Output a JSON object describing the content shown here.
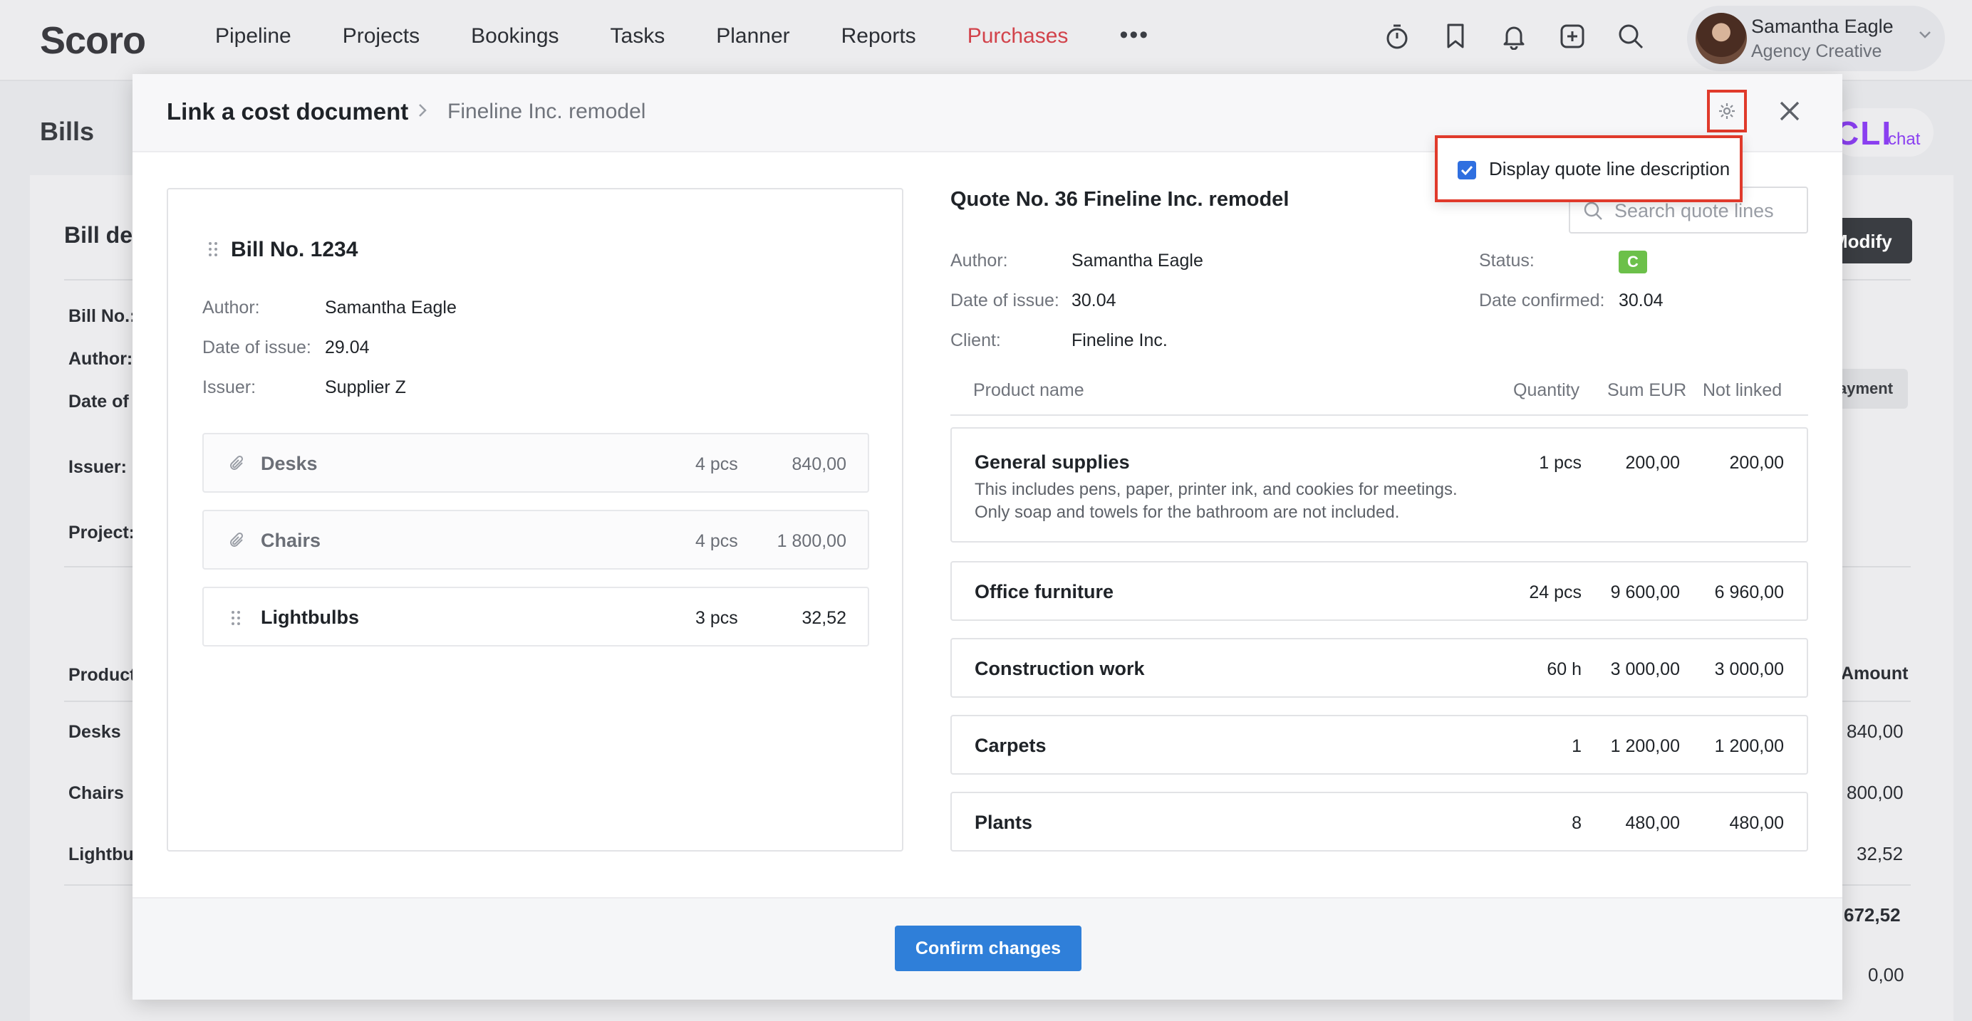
{
  "app": {
    "logo": "Scoro",
    "nav": [
      "Pipeline",
      "Projects",
      "Bookings",
      "Tasks",
      "Planner",
      "Reports",
      "Purchases"
    ],
    "nav_more": "•••",
    "user": {
      "name": "Samantha Eagle",
      "role": "Agency Creative"
    }
  },
  "background": {
    "page_title": "Bills",
    "chat_logo": "CLI",
    "chat_label": "chat",
    "section_title": "Bill de",
    "labels": [
      "Bill No.:",
      "Author:",
      "Date of",
      "Issuer:",
      "Project:"
    ],
    "modify_button": "Modify",
    "payment_button": "ayment",
    "table_header_product": "Product",
    "table_header_amount": "Amount",
    "rows": [
      {
        "product": "Desks",
        "amount": "840,00"
      },
      {
        "product": "Chairs",
        "amount": "800,00"
      },
      {
        "product": "Lightbu",
        "amount": "32,52"
      }
    ],
    "total": "672,52",
    "footer_value": "0,00"
  },
  "modal": {
    "title": "Link a cost document",
    "subtitle": "Fineline Inc. remodel",
    "settings_option": "Display quote line description",
    "settings_checked": true,
    "confirm_button": "Confirm changes",
    "bill": {
      "title": "Bill No. 1234",
      "author_label": "Author:",
      "author": "Samantha Eagle",
      "date_label": "Date of issue:",
      "date": "29.04",
      "issuer_label": "Issuer:",
      "issuer": "Supplier Z",
      "lines": [
        {
          "name": "Desks",
          "qty": "4 pcs",
          "sum": "840,00",
          "linked": true
        },
        {
          "name": "Chairs",
          "qty": "4 pcs",
          "sum": "1 800,00",
          "linked": true
        },
        {
          "name": "Lightbulbs",
          "qty": "3 pcs",
          "sum": "32,52",
          "linked": false
        }
      ]
    },
    "quote": {
      "title": "Quote No. 36 Fineline Inc. remodel",
      "search_placeholder": "Search quote lines",
      "author_label": "Author:",
      "author": "Samantha Eagle",
      "date_label": "Date of issue:",
      "date": "30.04",
      "client_label": "Client:",
      "client": "Fineline Inc.",
      "status_label": "Status:",
      "status": "C",
      "confirmed_label": "Date confirmed:",
      "confirmed": "30.04",
      "columns": [
        "Product name",
        "Quantity",
        "Sum EUR",
        "Not linked"
      ],
      "lines": [
        {
          "name": "General supplies",
          "qty": "1 pcs",
          "sum": "200,00",
          "not_linked": "200,00",
          "desc1": "This includes pens, paper, printer ink, and cookies for meetings.",
          "desc2": "Only soap and towels for the bathroom are not included."
        },
        {
          "name": "Office furniture",
          "qty": "24 pcs",
          "sum": "9 600,00",
          "not_linked": "6 960,00"
        },
        {
          "name": "Construction work",
          "qty": "60 h",
          "sum": "3 000,00",
          "not_linked": "3 000,00"
        },
        {
          "name": "Carpets",
          "qty": "1",
          "sum": "1 200,00",
          "not_linked": "1 200,00"
        },
        {
          "name": "Plants",
          "qty": "8",
          "sum": "480,00",
          "not_linked": "480,00"
        }
      ]
    }
  },
  "colors": {
    "accent": "#2f7fd9",
    "nav_active": "#d2434b",
    "highlight": "#e03a2b",
    "status_green": "#6cc04a"
  }
}
